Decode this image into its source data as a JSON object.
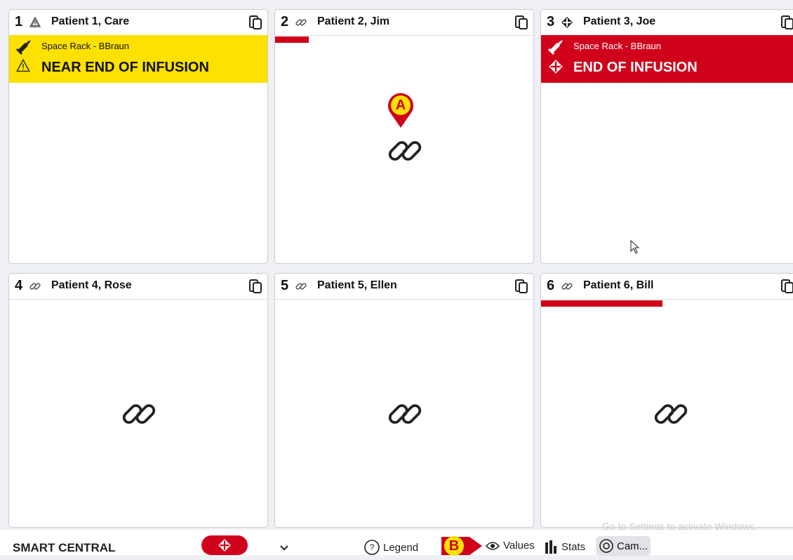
{
  "beds": [
    {
      "number": "1",
      "status": "warning",
      "name": "Patient 1, Care",
      "alarm": {
        "level": "yellow",
        "device": "Space Rack - BBraun",
        "message": "NEAR END OF INFUSION"
      }
    },
    {
      "number": "2",
      "status": "linked",
      "name": "Patient 2, Jim"
    },
    {
      "number": "3",
      "status": "alarm",
      "name": "Patient 3, Joe",
      "alarm": {
        "level": "red",
        "device": "Space Rack - BBraun",
        "message": "END OF INFUSION"
      }
    },
    {
      "number": "4",
      "status": "linked",
      "name": "Patient 4, Rose"
    },
    {
      "number": "5",
      "status": "linked",
      "name": "Patient 5, Ellen"
    },
    {
      "number": "6",
      "status": "linked",
      "name": "Patient 6, Bill"
    }
  ],
  "markers": {
    "a": "A",
    "b": "B"
  },
  "bottom_bar": {
    "app_name": "SMART CENTRAL",
    "legend": "Legend",
    "values": "Values",
    "stats": "Stats",
    "cam": "Cam..."
  },
  "watermark": "Go to Settings to activate Windows.",
  "colors": {
    "alarm_red": "#d0021b",
    "warning_yellow": "#fde100"
  }
}
